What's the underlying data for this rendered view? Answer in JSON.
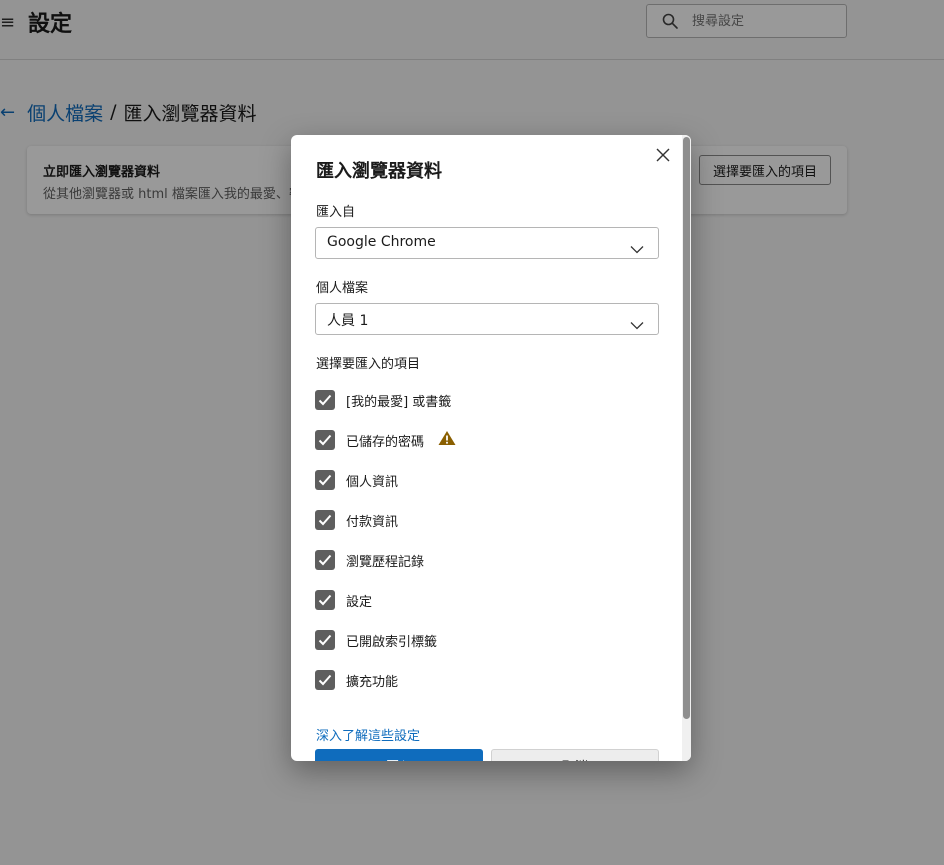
{
  "header": {
    "title": "設定",
    "menu_icon": "hamburger-icon",
    "search": {
      "placeholder": "搜尋設定",
      "icon": "search-icon"
    }
  },
  "breadcrumb": {
    "back_icon": "back-arrow-icon",
    "parent": "個人檔案",
    "separator": "/",
    "current": "匯入瀏覽器資料"
  },
  "card": {
    "title": "立即匯入瀏覽器資料",
    "description": "從其他瀏覽器或 html 檔案匯入我的最愛、密碼、歷程記錄、Cookie 及其他瀏覽器資料。",
    "button_label": "選擇要匯入的項目"
  },
  "dialog": {
    "title": "匯入瀏覽器資料",
    "close_icon": "close-icon",
    "import_from": {
      "label": "匯入自",
      "value": "Google Chrome"
    },
    "profile": {
      "label": "個人檔案",
      "value": "人員 1"
    },
    "items_label": "選擇要匯入的項目",
    "items": [
      {
        "label": "[我的最愛] 或書籤",
        "checked": true,
        "warning": false
      },
      {
        "label": "已儲存的密碼",
        "checked": true,
        "warning": true
      },
      {
        "label": "個人資訊",
        "checked": true,
        "warning": false
      },
      {
        "label": "付款資訊",
        "checked": true,
        "warning": false
      },
      {
        "label": "瀏覽歷程記錄",
        "checked": true,
        "warning": false
      },
      {
        "label": "設定",
        "checked": true,
        "warning": false
      },
      {
        "label": "已開啟索引標籤",
        "checked": true,
        "warning": false
      },
      {
        "label": "擴充功能",
        "checked": true,
        "warning": false
      }
    ],
    "learn_more": "深入了解這些設定",
    "primary_button": "匯入",
    "secondary_button": "取消"
  },
  "colors": {
    "accent": "#0f6cbd",
    "checkbox": "#5e5e5e",
    "warning": "#8a5f00",
    "scrim": "rgba(0,0,0,0.40)"
  }
}
